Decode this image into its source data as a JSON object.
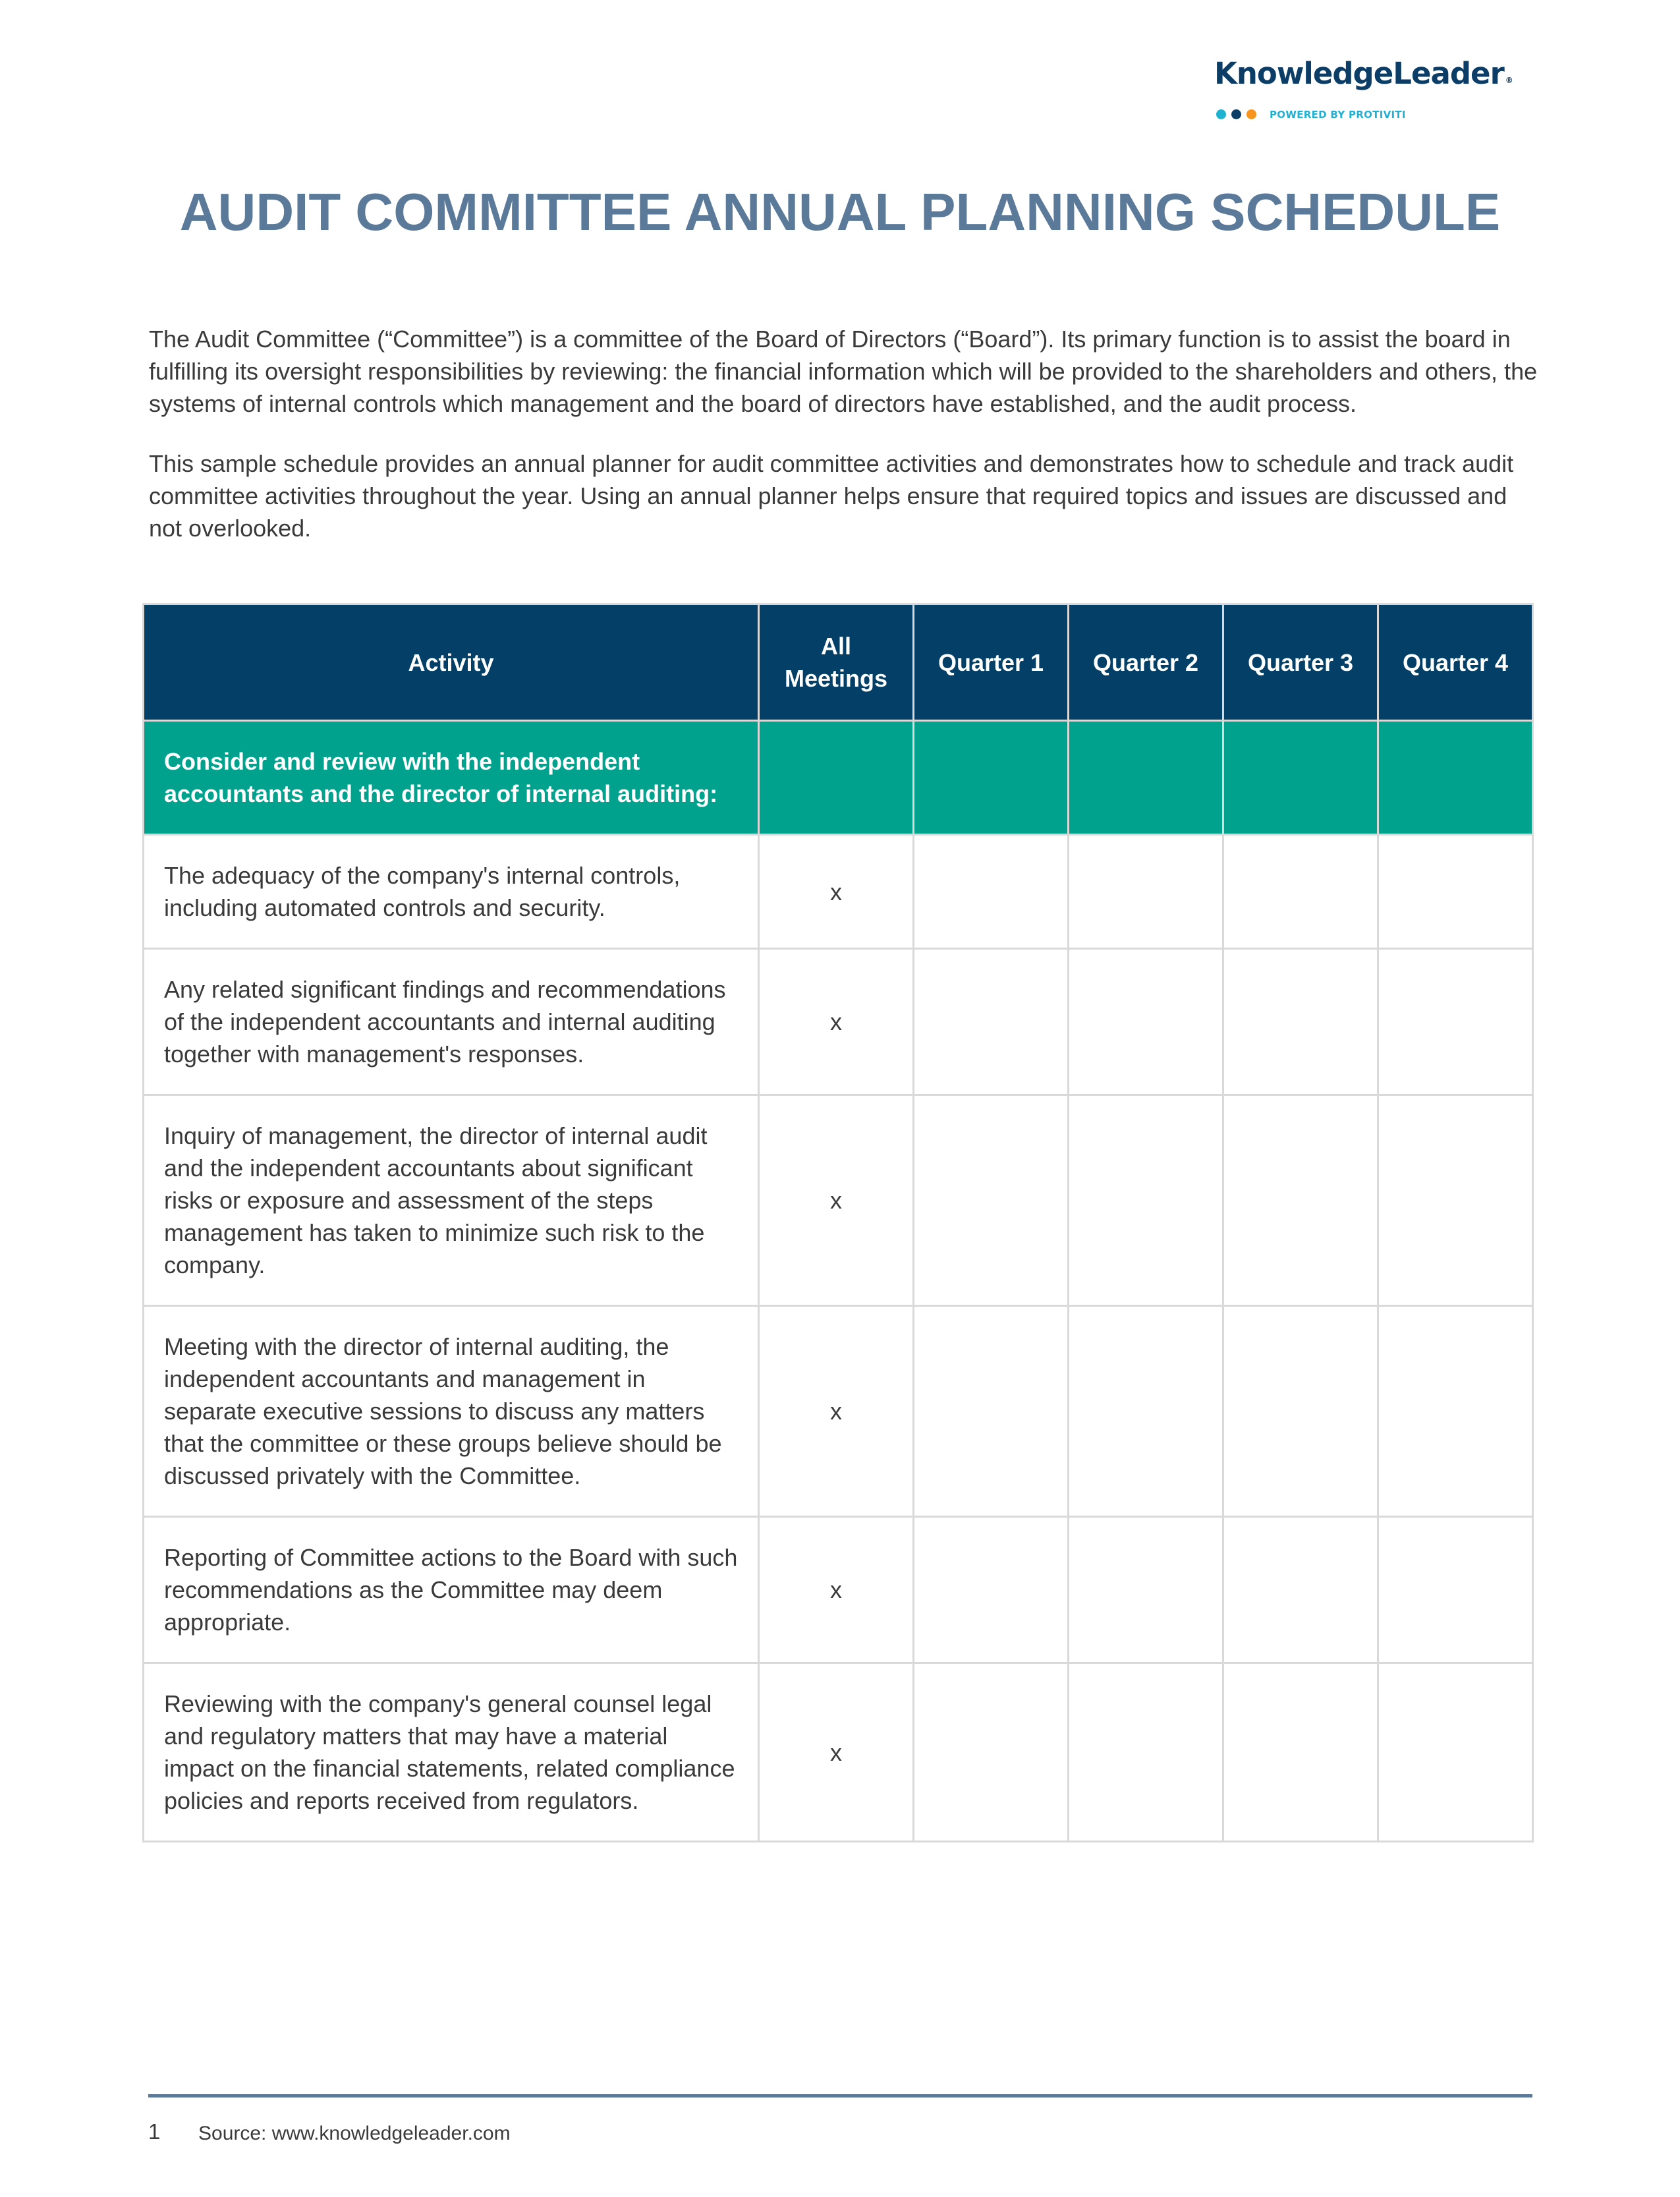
{
  "logo": {
    "wordmark": "KnowledgeLeader",
    "registered": "®",
    "tagline": "POWERED BY PROTIVITI",
    "dots": [
      {
        "name": "teal-dot",
        "color": "#1fb2d0"
      },
      {
        "name": "navy-dot",
        "color": "#0b3d66"
      },
      {
        "name": "orange-dot",
        "color": "#f7941d"
      }
    ]
  },
  "title": "AUDIT COMMITTEE ANNUAL PLANNING SCHEDULE",
  "intro": [
    "The Audit Committee (“Committee”) is a committee of the Board of Directors (“Board”). Its primary function is to assist the board in fulfilling its oversight responsibilities by reviewing: the financial information which will be provided to the shareholders and others, the systems of internal controls which management and the board of directors have established, and the audit process.",
    "This sample schedule provides an annual planner for audit committee activities and demonstrates how to schedule and track audit committee activities throughout the year. Using an annual planner helps ensure that required topics and issues are discussed and not overlooked."
  ],
  "table": {
    "headers": [
      "Activity",
      "All Meetings",
      "Quarter 1",
      "Quarter 2",
      "Quarter 3",
      "Quarter 4"
    ],
    "section": "Consider and review with the independent accountants and the director of internal auditing:",
    "rows": [
      {
        "activity": "The adequacy of the company's internal controls, including automated controls and security.",
        "all": "x",
        "q1": "",
        "q2": "",
        "q3": "",
        "q4": ""
      },
      {
        "activity": "Any related significant findings and recommendations of the independent accountants and internal auditing together with management's responses.",
        "all": "x",
        "q1": "",
        "q2": "",
        "q3": "",
        "q4": ""
      },
      {
        "activity": "Inquiry of management, the director of internal audit and the independent accountants about significant risks or exposure and assessment of the steps management has taken to minimize such risk to the company.",
        "all": "x",
        "q1": "",
        "q2": "",
        "q3": "",
        "q4": ""
      },
      {
        "activity": "Meeting with the director of internal auditing, the independent accountants and management in separate executive sessions to discuss any matters that the committee or these groups believe should be discussed privately with the Committee.",
        "all": "x",
        "q1": "",
        "q2": "",
        "q3": "",
        "q4": ""
      },
      {
        "activity": "Reporting of Committee actions to the Board with such recommendations as the Committee may deem appropriate.",
        "all": "x",
        "q1": "",
        "q2": "",
        "q3": "",
        "q4": ""
      },
      {
        "activity": "Reviewing with the company's general counsel legal and regulatory matters that may have a material impact on the financial statements, related compliance policies and reports received from regulators.",
        "all": "x",
        "q1": "",
        "q2": "",
        "q3": "",
        "q4": ""
      }
    ]
  },
  "colors": {
    "header_bg": "#033f66",
    "section_bg": "#00a28e",
    "title": "#5b7a99",
    "rule": "#5b7a99"
  },
  "footer": {
    "page_number": "1",
    "source": "Source: www.knowledgeleader.com"
  }
}
